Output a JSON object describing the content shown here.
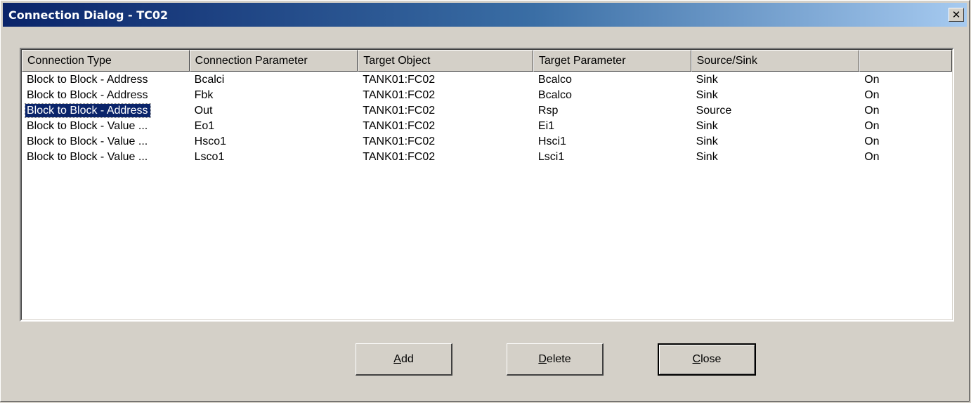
{
  "window": {
    "title": "Connection Dialog - TC02",
    "close_glyph": "✕"
  },
  "table": {
    "columns": [
      "Connection Type",
      "Connection Parameter",
      "Target Object",
      "Target Parameter",
      "Source/Sink",
      ""
    ],
    "rows": [
      [
        "Block to Block - Address",
        "Bcalci",
        "TANK01:FC02",
        "Bcalco",
        "Sink",
        "On"
      ],
      [
        "Block to Block - Address",
        "Fbk",
        "TANK01:FC02",
        "Bcalco",
        "Sink",
        "On"
      ],
      [
        "Block to Block - Address",
        "Out",
        "TANK01:FC02",
        "Rsp",
        "Source",
        "On"
      ],
      [
        "Block to Block - Value ...",
        "Eo1",
        "TANK01:FC02",
        "Ei1",
        "Sink",
        "On"
      ],
      [
        "Block to Block - Value ...",
        "Hsco1",
        "TANK01:FC02",
        "Hsci1",
        "Sink",
        "On"
      ],
      [
        "Block to Block - Value ...",
        "Lsco1",
        "TANK01:FC02",
        "Lsci1",
        "Sink",
        "On"
      ]
    ],
    "selected_row": 2
  },
  "buttons": {
    "add": {
      "accel": "A",
      "rest": "dd"
    },
    "delete": {
      "accel": "D",
      "rest": "elete"
    },
    "close": {
      "accel": "C",
      "rest": "lose"
    }
  },
  "colors": {
    "titlebar_start": "#0a246a",
    "titlebar_end": "#a6caf0",
    "selection": "#0a246a",
    "face": "#d4d0c8"
  }
}
